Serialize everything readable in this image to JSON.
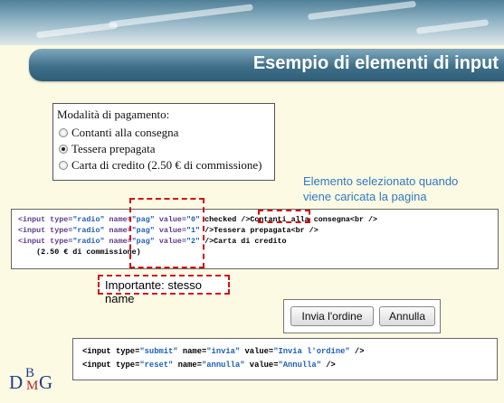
{
  "slide": {
    "title": "Esempio di elementi di input",
    "title_color": "#2e5d77",
    "background": "#fdfae3"
  },
  "form": {
    "legend": "Modalità di pagamento:",
    "options": [
      {
        "label": "Contanti alla consegna",
        "checked": false
      },
      {
        "label": "Tessera prepagata",
        "checked": true
      },
      {
        "label": "Carta di credito (2.50 € di commissione)",
        "checked": false
      }
    ]
  },
  "annotations": {
    "selected_note": "Elemento selezionato quando viene caricata la pagina",
    "important_note": "Importante: stesso name",
    "highlight_color": "#d01010",
    "note_color": "#2e78c7"
  },
  "radio_code": {
    "lines": [
      {
        "p1": "<input type=",
        "v1": "\"radio\"",
        "p2": " name=",
        "v2": "\"pag\"",
        "p3": " value=",
        "v3": "\"0\"",
        "p4": " checked />Contanti alla consegna<br />"
      },
      {
        "p1": "<input type=",
        "v1": "\"radio\"",
        "p2": " name=",
        "v2": "\"pag\"",
        "p3": " value=",
        "v3": "\"1\"",
        "p4": " />Tessera prepagata<br />"
      },
      {
        "p1": "<input type=",
        "v1": "\"radio\"",
        "p2": " name=",
        "v2": "\"pag\"",
        "p3": " value=",
        "v3": "\"2\"",
        "p4": " />Carta di credito"
      }
    ],
    "continuation": "    (2.50 € di commissione)"
  },
  "buttons": {
    "submit_label": "Invia l'ordine",
    "reset_label": "Annulla"
  },
  "button_code": {
    "lines": [
      {
        "p1": "<input type=",
        "v1": "\"submit\"",
        "p2": " name=",
        "v2": "\"invia\"",
        "p3": " value=",
        "v3": "\"Invia l'ordine\"",
        "p4": " />"
      },
      {
        "p1": "<input type=",
        "v1": "\"reset\"",
        "p2": " name=",
        "v2": "\"annulla\"",
        "p3": " value=",
        "v3": "\"Annulla\"",
        "p4": " />"
      }
    ]
  },
  "logo": {
    "parts": [
      "D",
      "B",
      "M",
      "G"
    ]
  }
}
